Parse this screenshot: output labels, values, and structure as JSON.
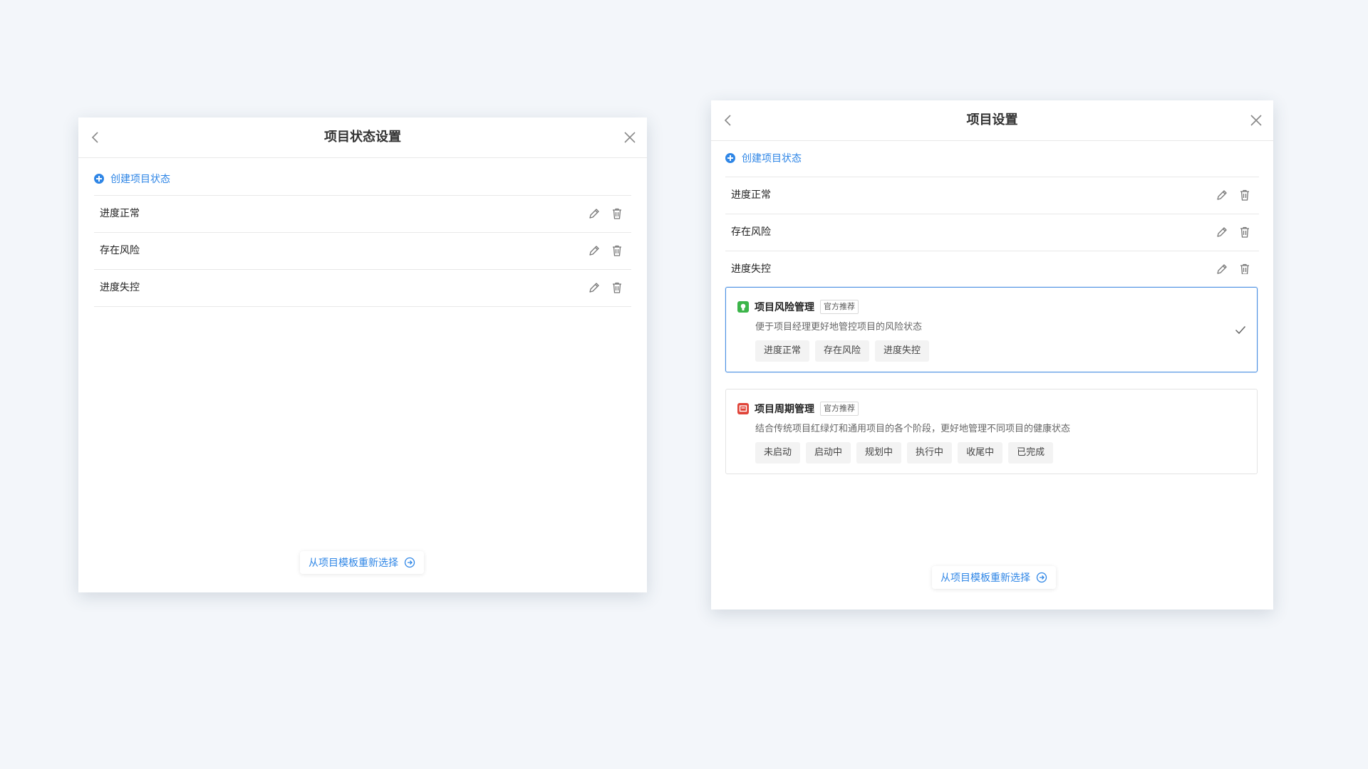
{
  "left_panel": {
    "title": "项目状态设置",
    "create_label": "创建项目状态",
    "statuses": [
      {
        "label": "进度正常"
      },
      {
        "label": "存在风险"
      },
      {
        "label": "进度失控"
      }
    ],
    "reselect_label": "从项目模板重新选择"
  },
  "right_panel": {
    "title": "项目设置",
    "create_label": "创建项目状态",
    "statuses": [
      {
        "label": "进度正常"
      },
      {
        "label": "存在风险"
      },
      {
        "label": "进度失控"
      }
    ],
    "templates": [
      {
        "name": "项目风险管理",
        "badge": "官方推荐",
        "description": "便于项目经理更好地管控项目的风险状态",
        "tags": [
          "进度正常",
          "存在风险",
          "进度失控"
        ],
        "selected": true,
        "icon": "bulb-icon",
        "color": "#3cb54a"
      },
      {
        "name": "项目周期管理",
        "badge": "官方推荐",
        "description": "结合传统项目红绿灯和通用项目的各个阶段，更好地管理不同项目的健康状态",
        "tags": [
          "未启动",
          "启动中",
          "规划中",
          "执行中",
          "收尾中",
          "已完成"
        ],
        "selected": false,
        "icon": "calendar-icon",
        "color": "#e0453a"
      }
    ],
    "reselect_label": "从项目模板重新选择"
  },
  "colors": {
    "accent": "#2f86e6",
    "selected_border": "#4a90e2",
    "background": "#f3f6fa"
  }
}
